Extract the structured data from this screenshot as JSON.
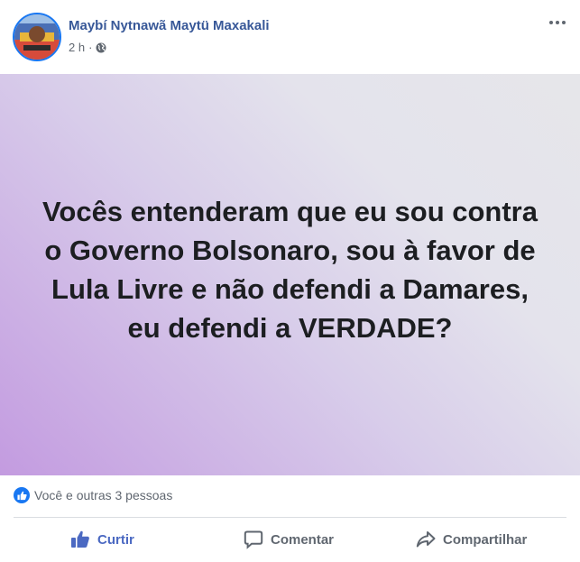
{
  "post": {
    "author": "Maybí Nytnawã Maytü Maxakali",
    "time": "2 h",
    "separator": "·",
    "privacy_icon": "globe-icon",
    "text": "Vocês entenderam que eu sou contra o Governo Bolsonaro, sou à favor de Lula Livre e não defendi a Damares, eu defendi a VERDADE?",
    "background_gradient": [
      "#c39be0",
      "#e6e6ea"
    ]
  },
  "reactions": {
    "icon": "like-icon",
    "summary": "Você e outras 3 pessoas"
  },
  "actions": {
    "like": {
      "label": "Curtir",
      "icon": "thumbs-up-icon"
    },
    "comment": {
      "label": "Comentar",
      "icon": "comment-icon"
    },
    "share": {
      "label": "Compartilhar",
      "icon": "share-icon"
    }
  },
  "colors": {
    "author_link": "#385898",
    "like_active": "#4b69c2",
    "brand_blue": "#1877f2",
    "secondary_text": "#606770"
  }
}
